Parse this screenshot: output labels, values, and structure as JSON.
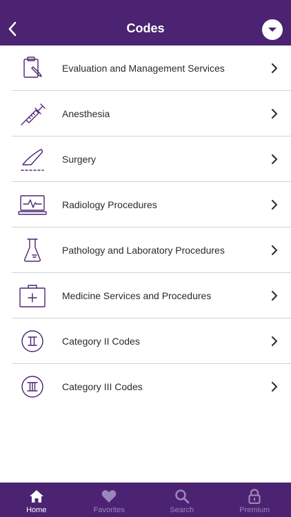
{
  "header": {
    "title": "Codes",
    "back_icon": "chevron-left-icon",
    "menu_icon": "chevron-down-circle-icon"
  },
  "list": {
    "items": [
      {
        "label": "Evaluation and Management Services",
        "icon": "clipboard-pen-icon"
      },
      {
        "label": "Anesthesia",
        "icon": "syringe-icon"
      },
      {
        "label": "Surgery",
        "icon": "scalpel-icon"
      },
      {
        "label": "Radiology Procedures",
        "icon": "monitor-pulse-icon"
      },
      {
        "label": "Pathology and Laboratory Procedures",
        "icon": "flask-icon"
      },
      {
        "label": "Medicine Services and Procedures",
        "icon": "medical-kit-icon"
      },
      {
        "label": "Category II Codes",
        "icon": "roman-two-icon"
      },
      {
        "label": "Category III Codes",
        "icon": "roman-three-icon"
      }
    ]
  },
  "tabbar": {
    "tabs": [
      {
        "label": "Home",
        "icon": "home-icon",
        "active": true
      },
      {
        "label": "Favorites",
        "icon": "heart-icon",
        "active": false
      },
      {
        "label": "Search",
        "icon": "search-icon",
        "active": false
      },
      {
        "label": "Premium",
        "icon": "lock-icon",
        "active": false
      }
    ]
  },
  "colors": {
    "brand": "#4b2372",
    "icon_stroke": "#4b2372",
    "divider": "#d2d2d2",
    "tab_inactive": "#9c86b9",
    "tab_active": "#ffffff"
  }
}
